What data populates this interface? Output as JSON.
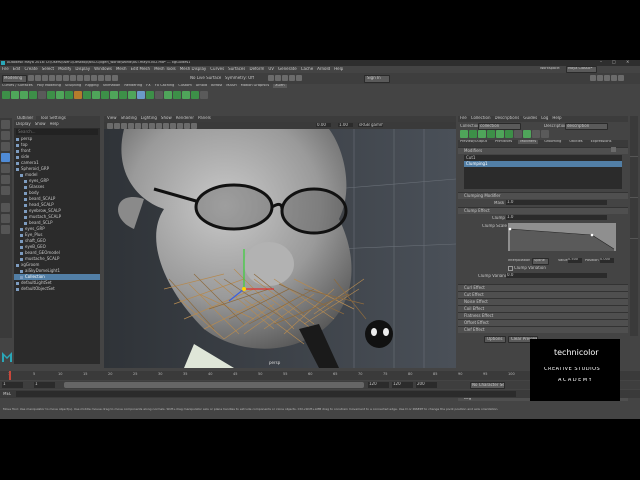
{
  "window": {
    "title": "Autodesk Maya 2018: D:\\Users\\user1\\Desktop\\NSCG\\xgen_world\\World\\BST.mayd.v02.ma*  ---  xgGuides1",
    "controls": [
      "–",
      "□",
      "×"
    ]
  },
  "menubar": [
    "File",
    "Edit",
    "Create",
    "Select",
    "Modify",
    "Display",
    "Windows",
    "Mesh",
    "Edit Mesh",
    "Mesh Tools",
    "Mesh Display",
    "Curves",
    "Surfaces",
    "Deform",
    "UV",
    "Generate",
    "Cache",
    "Arnold",
    "Help"
  ],
  "workspace": {
    "label": "Workspace:",
    "value": "Maya Classic*"
  },
  "statusline": {
    "mode": "Modeling",
    "no_live": "No Live Surface",
    "symmetry": "Symmetry: Off",
    "sign_in": "Sign In"
  },
  "shelf_tabs": [
    "Curves / Surfaces",
    "Poly Modeling",
    "Sculpting",
    "Rigging",
    "Animation",
    "Rendering",
    "FX",
    "FX Caching",
    "Custom",
    "Arnold",
    "Bifrost",
    "MASH",
    "Motion Graphics",
    "XGen"
  ],
  "outliner": {
    "title": "Outliner",
    "tab2": "Tool Settings",
    "menu": [
      "Display",
      "Show",
      "Help"
    ],
    "search_placeholder": "Search...",
    "items": [
      {
        "label": "persp",
        "indent": 0
      },
      {
        "label": "top",
        "indent": 0
      },
      {
        "label": "front",
        "indent": 0
      },
      {
        "label": "side",
        "indent": 0
      },
      {
        "label": "camera1",
        "indent": 0
      },
      {
        "label": "Spheroid_GRP",
        "indent": 0
      },
      {
        "label": "model",
        "indent": 1
      },
      {
        "label": "eyes_GRP",
        "indent": 2
      },
      {
        "label": "Glasses",
        "indent": 2
      },
      {
        "label": "body",
        "indent": 2
      },
      {
        "label": "beard_SCALP",
        "indent": 2
      },
      {
        "label": "head_SCALP",
        "indent": 2
      },
      {
        "label": "eyebrow_SCALP",
        "indent": 2
      },
      {
        "label": "mustach_SCALP",
        "indent": 2
      },
      {
        "label": "beard_SCLP",
        "indent": 2
      },
      {
        "label": "eyes_GRP",
        "indent": 1
      },
      {
        "label": "Eye_Plus",
        "indent": 1
      },
      {
        "label": "shaft_GEO",
        "indent": 1
      },
      {
        "label": "eyeB_GEO",
        "indent": 1
      },
      {
        "label": "beard_GEOmodel",
        "indent": 1
      },
      {
        "label": "mustache_SCALP",
        "indent": 1
      },
      {
        "label": "xgGroom",
        "indent": 0
      },
      {
        "label": "aiSkyDomeLight1",
        "indent": 1
      },
      {
        "label": "Collection",
        "indent": 1,
        "selected": true
      },
      {
        "label": "defaultLightSet",
        "indent": 0
      },
      {
        "label": "defaultObjectSet",
        "indent": 0
      }
    ]
  },
  "viewport": {
    "menu": [
      "View",
      "Shading",
      "Lighting",
      "Show",
      "Renderer",
      "Panels"
    ],
    "camera_label": "persp",
    "colorspace": "sRGB gamma",
    "value1": "0.00",
    "value2": "1.00"
  },
  "xgen": {
    "menu": [
      "File",
      "Collection",
      "Descriptions",
      "Guides",
      "Log",
      "Help"
    ],
    "collection_label": "Collection",
    "collection_value": "collection",
    "description_label": "Description",
    "description_value": "description",
    "tabs": [
      "Preview/Output",
      "Primitives",
      "Modifiers",
      "Grooming",
      "Utilities",
      "Expressions"
    ],
    "active_tab": "Modifiers",
    "modifiers_header": "Modifiers",
    "modifiers_list": [
      "Cut1",
      "Clumping1"
    ],
    "clumping_header": "Clumping Modifier",
    "mask_label": "Mask",
    "mask_value": "1.0",
    "clump_effect_header": "Clump Effect",
    "clump_label": "Clump",
    "clump_value": "1.0",
    "clump_scale_label": "Clump Scale",
    "interp_label": "Interpolation",
    "interp_value": "Spline",
    "value_label": "Value",
    "value_value": "0.500",
    "position_label": "Position",
    "position_value": "0.000",
    "clump_variance_label": "Clump Variance",
    "clump_variance_value": "0.0",
    "use_variation": "Clump Variation",
    "sections": [
      "Curl Effect",
      "Cut Effect",
      "Noise Effect",
      "Coil Effect",
      "Flatness Effect",
      "Offset Effect",
      "Clef Effect"
    ],
    "footer": [
      "Options",
      "Clear Previews"
    ],
    "log": "Log"
  },
  "timeline": {
    "ticks": [
      "1",
      "5",
      "10",
      "15",
      "20",
      "25",
      "30",
      "35",
      "40",
      "45",
      "50",
      "55",
      "60",
      "65",
      "70",
      "75",
      "80",
      "85",
      "90",
      "95",
      "100",
      "105",
      "110",
      "115",
      "120"
    ],
    "start": "1",
    "start2": "1",
    "end": "120",
    "end2": "200",
    "range_end": "120",
    "char_set": "No Character Set",
    "anim_layer": "No Anim Layer",
    "fps": "24 fps"
  },
  "commandline": {
    "label": "MEL"
  },
  "helpline": "Move Tool: Use manipulator to move object(s). Use middle mouse drag to move components along normals. Shift+drag manipulator axis or plane handles to extrude components or clone objects. Ctrl+Shift+LMB drag to constrain movement to a connected edge. Use D or INSERT to change the pivot position and axis orientation.",
  "watermark": {
    "line1": "technicolor",
    "line2": "CREATIVE STUDIOS",
    "line3": "ACADEMY"
  },
  "colors": {
    "accent": "#4f8bd6",
    "selection": "#527fa6",
    "watermark_bg": "#000000"
  }
}
